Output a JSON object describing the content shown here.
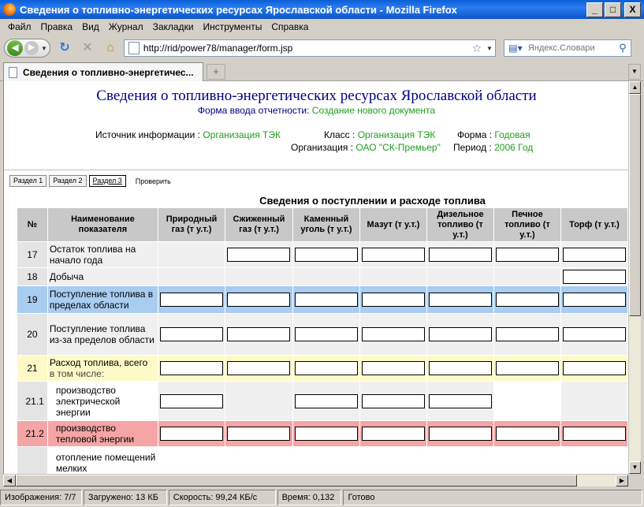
{
  "window": {
    "title": "Сведения о топливно-энергетических ресурсах Ярославской области - Mozilla Firefox",
    "buttons": {
      "minimize": "_",
      "maximize": "□",
      "close": "X"
    }
  },
  "menu": [
    "Файл",
    "Правка",
    "Вид",
    "Журнал",
    "Закладки",
    "Инструменты",
    "Справка"
  ],
  "toolbar": {
    "url": "http://rid/power78/manager/form.jsp",
    "search_placeholder": "Яндекс.Словари"
  },
  "tab": {
    "title": "Сведения о топливно-энергетичес...",
    "new_tab": "+"
  },
  "page": {
    "title": "Сведения о топливно-энергетических ресурсах Ярославской области",
    "subtitle_label": "Форма ввода отчетности:",
    "subtitle_value": "Создание нового документа",
    "source_label": "Источник информации :",
    "source_value": "Организация ТЭК",
    "class_label": "Класс :",
    "class_value": "Организация ТЭК",
    "form_label": "Форма :",
    "form_value": "Годовая",
    "org_label": "Организация :",
    "org_value": "ОАО \"СК-Премьер\"",
    "period_label": "Период :",
    "period_value": "2006 Год",
    "section_tabs": [
      "Раздел 1",
      "Раздел 2",
      "Раздел 3"
    ],
    "active_section": "Раздел 3",
    "check_link": "Проверить",
    "table_title": "Сведения о поступлении и расходе топлива",
    "columns": {
      "num": "№",
      "name": "Наименование показателя",
      "fuels": [
        "Природный газ (т у.т.)",
        "Сжиженный газ (т у.т.)",
        "Каменный уголь (т у.т.)",
        "Мазут (т у.т.)",
        "Дизельное топливо (т у.т.)",
        "Печное топливо (т у.т.)",
        "Торф (т у.т.)"
      ]
    },
    "rows": [
      {
        "num": "17",
        "name": "Остаток топлива на начало года",
        "name_sub": "",
        "style": "plain",
        "cells": [
          false,
          true,
          true,
          true,
          true,
          true,
          true
        ]
      },
      {
        "num": "18",
        "name": "Добыча",
        "name_sub": "",
        "style": "plain",
        "cells": [
          false,
          false,
          false,
          false,
          false,
          false,
          true
        ]
      },
      {
        "num": "19",
        "name": "Поступление топлива в пределах области",
        "name_sub": "",
        "style": "blue",
        "cells": [
          true,
          true,
          true,
          true,
          true,
          true,
          true
        ]
      },
      {
        "num": "20",
        "name": "Поступление топлива из-за пределов области",
        "name_sub": "",
        "style": "plain",
        "cells": [
          true,
          true,
          true,
          true,
          true,
          true,
          true
        ]
      },
      {
        "num": "21",
        "name": "Расход топлива, всего",
        "name_sub": "в том числе:",
        "style": "yellow",
        "cells": [
          true,
          true,
          true,
          true,
          true,
          true,
          true
        ]
      },
      {
        "num": "21.1",
        "name": "производство электрической энергии",
        "name_sub": "",
        "style": "white",
        "cells": [
          true,
          false,
          true,
          true,
          true,
          "none",
          false
        ]
      },
      {
        "num": "21.2",
        "name": "производство тепловой энергии",
        "name_sub": "",
        "style": "red",
        "cells": [
          true,
          true,
          true,
          true,
          true,
          true,
          true
        ]
      },
      {
        "num": "",
        "name": "отопление помещений мелких",
        "name_sub": "",
        "style": "white",
        "cells": [
          "none",
          "none",
          "none",
          "none",
          "none",
          "none",
          "none"
        ]
      }
    ]
  },
  "status": {
    "images": "Изображения: 7/7",
    "loaded": "Загружено: 13 КБ",
    "speed": "Скорость: 99,24 КБ/с",
    "time": "Время: 0,132",
    "done": "Готово"
  }
}
